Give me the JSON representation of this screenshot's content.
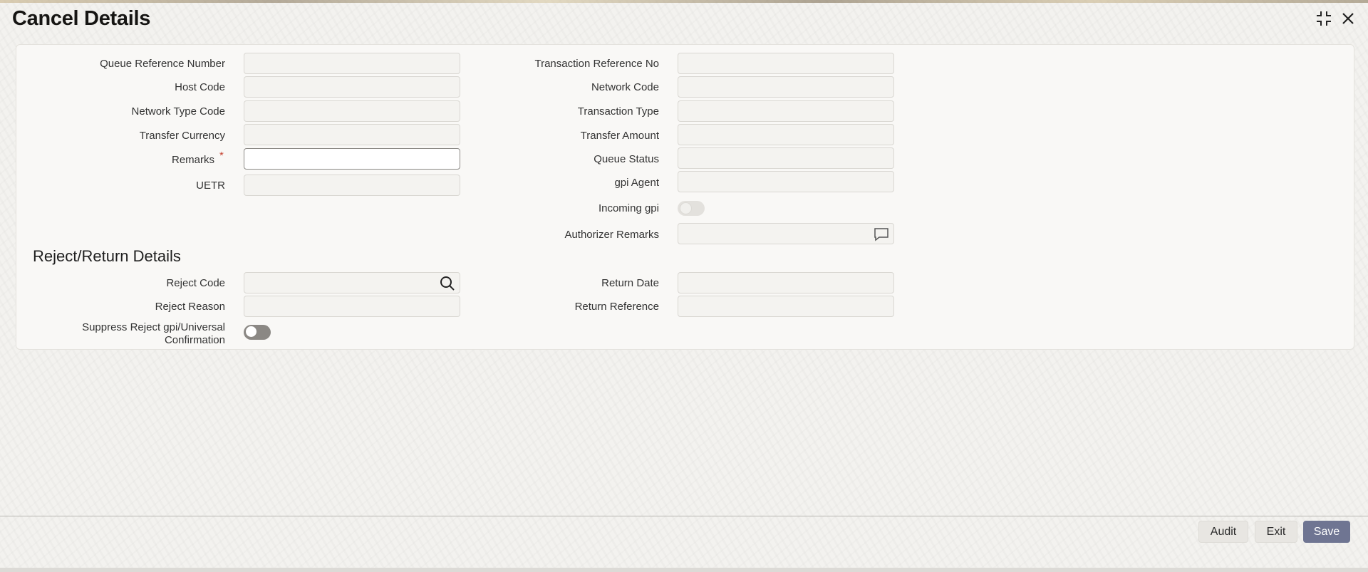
{
  "window": {
    "title": "Cancel Details",
    "maximize_icon": "fullscreen-exit-icon",
    "close_icon": "close-icon"
  },
  "form": {
    "left": [
      {
        "label": "Queue Reference Number",
        "value": ""
      },
      {
        "label": "Host Code",
        "value": ""
      },
      {
        "label": "Network Type Code",
        "value": ""
      },
      {
        "label": "Transfer Currency",
        "value": ""
      },
      {
        "label": "Remarks",
        "value": "",
        "required": true
      },
      {
        "label": "UETR",
        "value": ""
      }
    ],
    "right": [
      {
        "label": "Transaction Reference No",
        "value": ""
      },
      {
        "label": "Network Code",
        "value": ""
      },
      {
        "label": "Transaction Type",
        "value": ""
      },
      {
        "label": "Transfer Amount",
        "value": ""
      },
      {
        "label": "Queue Status",
        "value": ""
      },
      {
        "label": "gpi Agent",
        "value": ""
      },
      {
        "label": "Incoming gpi",
        "toggle": false
      },
      {
        "label": "Authorizer Remarks",
        "value": "",
        "icon": "comment-icon"
      }
    ],
    "required_marker": "*"
  },
  "reject_return": {
    "heading": "Reject/Return Details",
    "reject_code": {
      "label": "Reject Code",
      "value": "",
      "icon": "search-icon"
    },
    "reject_reason": {
      "label": "Reject Reason",
      "value": ""
    },
    "suppress": {
      "label_line1": "Suppress Reject gpi/Universal",
      "label_line2": "Confirmation",
      "toggle": false
    },
    "return_date": {
      "label": "Return Date",
      "value": ""
    },
    "return_reference": {
      "label": "Return Reference",
      "value": ""
    }
  },
  "footer": {
    "audit_label": "Audit",
    "exit_label": "Exit",
    "save_label": "Save"
  },
  "colors": {
    "primary_button": "#6f7592",
    "required": "#c74634"
  }
}
